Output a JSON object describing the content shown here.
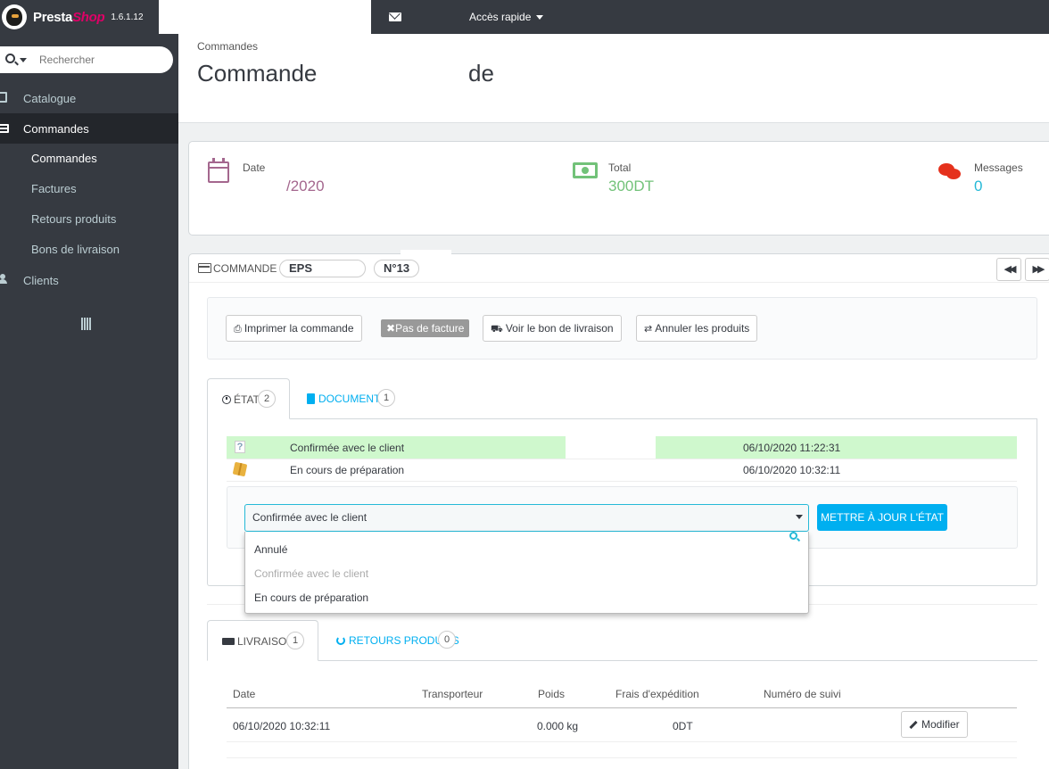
{
  "topbar": {
    "logo_brand_a": "Presta",
    "logo_brand_b": "Shop",
    "version": "1.6.1.12",
    "quick_access": "Accès rapide"
  },
  "sidebar": {
    "search_placeholder": "Rechercher",
    "items": [
      {
        "label": "Catalogue",
        "icon": "book-icon"
      },
      {
        "label": "Commandes",
        "icon": "credit-card-icon",
        "active": true
      },
      {
        "label": "Clients",
        "icon": "users-icon"
      }
    ],
    "sub_items": [
      {
        "label": "Commandes",
        "active": true
      },
      {
        "label": "Factures"
      },
      {
        "label": "Retours produits"
      },
      {
        "label": "Bons de livraison"
      }
    ]
  },
  "header": {
    "breadcrumb": "Commandes",
    "title_a": "Commande",
    "title_b": "de"
  },
  "kpi": {
    "date_label": "Date",
    "date_value": "/2020",
    "total_label": "Total",
    "total_value": "300DT",
    "messages_label": "Messages",
    "messages_value": "0",
    "colors": {
      "date": "#a4678e",
      "total": "#72c279",
      "messages": "#25b9d7"
    }
  },
  "order": {
    "heading_label": "COMMANDE",
    "reference": "EPS",
    "number": "N°13",
    "actions": {
      "print": "Imprimer la commande",
      "no_invoice": "Pas de facture",
      "delivery_slip": "Voir le bon de livraison",
      "cancel_products": "Annuler les produits"
    },
    "tabs": {
      "state_label": "ÉTAT",
      "state_count": "2",
      "documents_label": "DOCUMENTS",
      "documents_count": "1"
    },
    "history": [
      {
        "status": "Confirmée avec le client",
        "date": "06/10/2020 11:22:31"
      },
      {
        "status": "En cours de préparation",
        "date": "06/10/2020 10:32:11"
      }
    ],
    "state_select": {
      "selected": "Confirmée avec le client",
      "options": [
        "Annulé",
        "Confirmée avec le client",
        "En cours de préparation"
      ]
    },
    "update_button": "METTRE À JOUR L'ÉTAT",
    "shipping_tabs": {
      "delivery_label": "LIVRAISON",
      "delivery_count": "1",
      "returns_label": "RETOURS PRODUITS",
      "returns_count": "0"
    },
    "shipping_table": {
      "headers": [
        "Date",
        "Transporteur",
        "Poids",
        "Frais d'expédition",
        "Numéro de suivi"
      ],
      "rows": [
        {
          "date": "06/10/2020 10:32:11",
          "carrier": "",
          "weight": "0.000 kg",
          "cost": "0DT",
          "tracking": ""
        }
      ],
      "edit_button": "Modifier"
    }
  }
}
